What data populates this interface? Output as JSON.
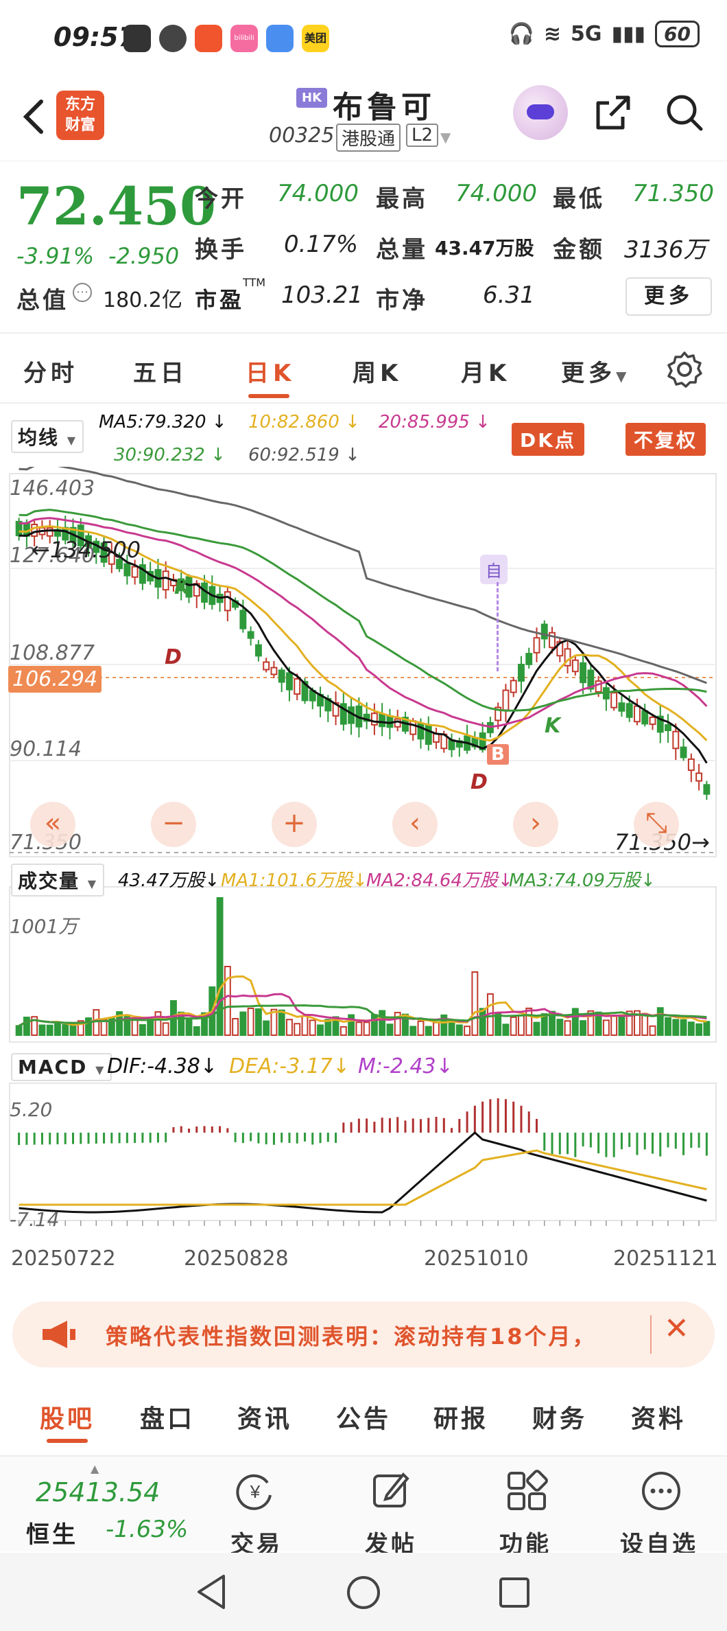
{
  "status_bar": {
    "time": "09:57",
    "network": "5G",
    "battery": "60",
    "app_icons": [
      "n-icon",
      "alarm-icon",
      "feishu-icon",
      "bilibili-icon",
      "message-icon",
      "meituan-icon"
    ],
    "meituan_label": "美团",
    "bilibili_label": "bilibili"
  },
  "header": {
    "logo_line1": "东方",
    "logo_line2": "财富",
    "market_badge": "HK",
    "stock_name": "布鲁可",
    "stock_code": "00325",
    "tag1": "港股通",
    "tag2": "L2"
  },
  "quote": {
    "price": "72.450",
    "change_pct": "-3.91%",
    "change_amt": "-2.950",
    "open_label": "今开",
    "open": "74.000",
    "high_label": "最高",
    "high": "74.000",
    "low_label": "最低",
    "low": "71.350",
    "turnover_label": "换手",
    "turnover": "0.17%",
    "volume_label": "总量",
    "volume": "43.47万股",
    "amount_label": "金额",
    "amount": "3136万",
    "mktcap_label": "总值",
    "mktcap": "180.2亿",
    "pe_label": "市盈",
    "pe_sup": "TTM",
    "pe": "103.21",
    "pb_label": "市净",
    "pb": "6.31",
    "more_label": "更多"
  },
  "period_tabs": [
    "分时",
    "五日",
    "日K",
    "周K",
    "月K",
    "更多"
  ],
  "ma_header": {
    "selector": "均线",
    "ma5": "MA5:79.320 ↓",
    "ma10": "10:82.860 ↓",
    "ma20": "20:85.995 ↓",
    "ma30": "30:90.232 ↓",
    "ma60": "60:92.519 ↓",
    "dk_button": "DK点",
    "fq_button": "不复权",
    "colors": {
      "ma5": "#111111",
      "ma10": "#e3b020",
      "ma20": "#c8398f",
      "ma30": "#3a9a3a",
      "ma60": "#666666"
    }
  },
  "kline": {
    "y_labels": [
      "146.403",
      "127.640",
      "108.877",
      "90.114",
      "71.350"
    ],
    "marker_price": "106.294",
    "high_annotation": "←134.500",
    "low_annotation": "71.350→",
    "tags": {
      "k": "K",
      "d": "D",
      "b": "B",
      "auto": "自"
    },
    "controls": [
      "«",
      "−",
      "+",
      "‹",
      "›",
      "⤡"
    ]
  },
  "volume": {
    "selector": "成交量",
    "vol": "43.47万股↓",
    "ma1": "MA1:101.6万股↓",
    "ma2": "MA2:84.64万股↓",
    "ma3": "MA3:74.09万股↓",
    "max_label": "1001万"
  },
  "macd": {
    "selector": "MACD",
    "dif": "DIF:-4.38↓",
    "dea": "DEA:-3.17↓",
    "m": "M:-2.43↓",
    "top": "5.20",
    "bottom": "-7.14"
  },
  "x_axis": [
    "20250722",
    "20250828",
    "20251010",
    "20251121"
  ],
  "banner": {
    "text": "策略代表性指数回测表明：滚动持有18个月，",
    "close": "✕"
  },
  "bottom_tabs": [
    "股吧",
    "盘口",
    "资讯",
    "公告",
    "研报",
    "财务",
    "资料"
  ],
  "footer": {
    "index_value": "25413.54",
    "index_name": "恒生",
    "index_change": "-1.63%",
    "nav": [
      "交易",
      "发帖",
      "功能",
      "设自选"
    ]
  }
}
